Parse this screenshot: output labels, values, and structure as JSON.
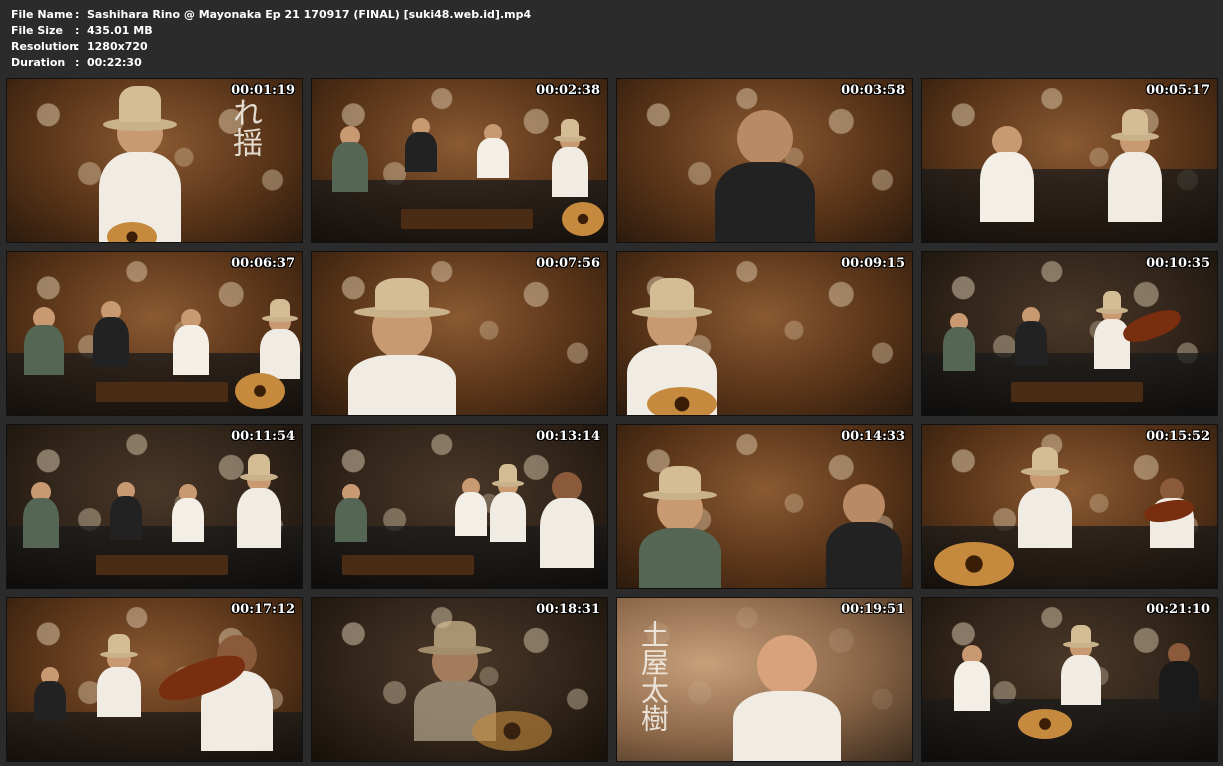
{
  "file_info": [
    {
      "label": "File Name",
      "value": "Sashihara Rino @ Mayonaka Ep 21 170917 (FINAL) [suki48.web.id].mp4"
    },
    {
      "label": "File Size",
      "value": "435.01 MB"
    },
    {
      "label": "Resolution",
      "value": "1280x720"
    },
    {
      "label": "Duration",
      "value": "00:22:30"
    }
  ],
  "separator": ":",
  "thumbnails": [
    {
      "timestamp": "00:01:19"
    },
    {
      "timestamp": "00:02:38"
    },
    {
      "timestamp": "00:03:58"
    },
    {
      "timestamp": "00:05:17"
    },
    {
      "timestamp": "00:06:37"
    },
    {
      "timestamp": "00:07:56"
    },
    {
      "timestamp": "00:09:15"
    },
    {
      "timestamp": "00:10:35"
    },
    {
      "timestamp": "00:11:54"
    },
    {
      "timestamp": "00:13:14"
    },
    {
      "timestamp": "00:14:33"
    },
    {
      "timestamp": "00:15:52"
    },
    {
      "timestamp": "00:17:12"
    },
    {
      "timestamp": "00:18:31"
    },
    {
      "timestamp": "00:19:51"
    },
    {
      "timestamp": "00:21:10"
    }
  ],
  "captions": {
    "thumb1": "れ揺",
    "thumb15": "土屋太樹"
  },
  "colors": {
    "background": "#2b2b2b",
    "text": "#ffffff",
    "wallpaper": "#5a3519"
  }
}
